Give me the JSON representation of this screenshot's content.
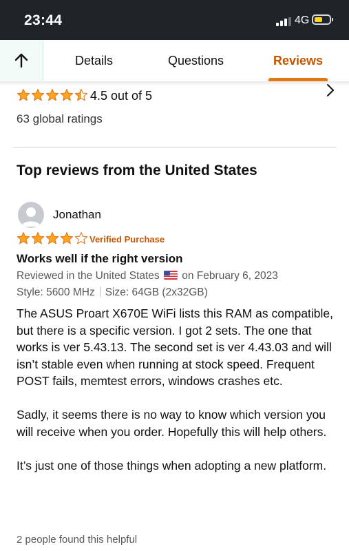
{
  "status_bar": {
    "time": "23:44",
    "network": "4G"
  },
  "tabs": [
    {
      "label": "Details",
      "active": false
    },
    {
      "label": "Questions",
      "active": false
    },
    {
      "label": "Reviews",
      "active": true
    }
  ],
  "rating_summary": {
    "stars": 4.5,
    "text": "4.5 out of 5",
    "global_ratings": "63 global ratings"
  },
  "section_title": "Top reviews from the United States",
  "review": {
    "reviewer": "Jonathan",
    "stars": 4,
    "verified_label": "Verified Purchase",
    "title": "Works well if the right version",
    "meta_prefix": "Reviewed in the United States",
    "meta_suffix": "on February 6, 2023",
    "style": "Style: 5600 MHz",
    "size": "Size: 64GB (2x32GB)",
    "body": [
      "The ASUS Proart X670E WiFi lists this RAM as compatible, but there is a specific version. I got 2 sets. The one that works is ver 5.43.13. The second set is ver 4.43.03 and will isn’t stable even when running at stock speed. Frequent POST fails, memtest errors, windows crashes etc.",
      "Sadly, it seems there is no way to know which version you will receive when you order. Hopefully this will help others.",
      "It’s just one of those things when adopting a new platform."
    ],
    "helpful": "2 people found this helpful"
  },
  "colors": {
    "accent": "#c45500",
    "star": "#ffa41c",
    "tab_underline": "#e47911",
    "status_bar_bg": "#1f2429"
  }
}
